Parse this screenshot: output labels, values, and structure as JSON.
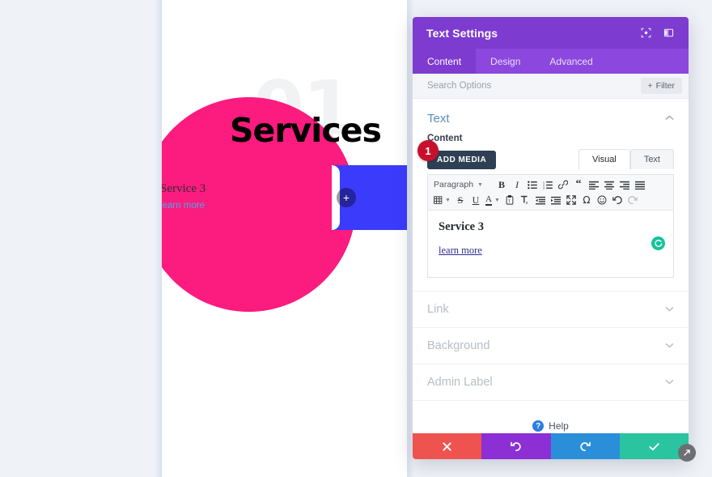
{
  "canvas": {
    "watermark_number": "01",
    "section_heading": "Services",
    "service_title": "Service 3",
    "service_link": "learn more",
    "add_module_glyph": "+",
    "colors": {
      "page_background": "#eff2f7",
      "canvas_background": "#ffffff",
      "pink_circle": "#fc1b7e",
      "blue_rect": "#3b3bfc",
      "watermark": "#f1f2f4",
      "heading": "#000000",
      "link": "#49a7e9"
    }
  },
  "modal": {
    "title": "Text Settings",
    "header_icons": [
      {
        "name": "fullscreen-target-icon"
      },
      {
        "name": "panel-layout-icon"
      }
    ],
    "tabs": [
      {
        "label": "Content",
        "active": true
      },
      {
        "label": "Design",
        "active": false
      },
      {
        "label": "Advanced",
        "active": false
      }
    ],
    "search": {
      "placeholder": "Search Options",
      "value": "",
      "filter_label": "Filter",
      "filter_glyph": "+"
    },
    "text_section": {
      "title": "Text",
      "expanded": true,
      "chevron": "⌃",
      "content_label": "Content",
      "add_media_label": "ADD MEDIA",
      "editor_tabs": [
        {
          "label": "Visual",
          "active": true
        },
        {
          "label": "Text",
          "active": false
        }
      ],
      "toolbar": {
        "paragraph_label": "Paragraph",
        "row1": [
          {
            "name": "bold-icon",
            "glyph": "B"
          },
          {
            "name": "italic-icon",
            "glyph": "I"
          },
          {
            "name": "bulleted-list-icon",
            "glyph": "☰"
          },
          {
            "name": "numbered-list-icon",
            "glyph": "≡"
          },
          {
            "name": "link-icon",
            "glyph": "🔗"
          },
          {
            "name": "blockquote-icon",
            "glyph": "“"
          },
          {
            "name": "align-left-icon",
            "glyph": "≡"
          },
          {
            "name": "align-center-icon",
            "glyph": "≡"
          },
          {
            "name": "align-right-icon",
            "glyph": "≡"
          },
          {
            "name": "align-justify-icon",
            "glyph": "≡"
          }
        ],
        "row2": [
          {
            "name": "table-icon",
            "glyph": "⊞"
          },
          {
            "name": "strikethrough-icon",
            "glyph": "S"
          },
          {
            "name": "underline-icon",
            "glyph": "U"
          },
          {
            "name": "text-color-icon",
            "glyph": "A"
          },
          {
            "name": "paste-as-text-icon",
            "glyph": "📋"
          },
          {
            "name": "clear-formatting-icon",
            "glyph": "T"
          },
          {
            "name": "outdent-icon",
            "glyph": "≡"
          },
          {
            "name": "indent-icon",
            "glyph": "≡"
          },
          {
            "name": "fullscreen-icon",
            "glyph": "⤢"
          },
          {
            "name": "special-character-icon",
            "glyph": "Ω"
          },
          {
            "name": "emoji-icon",
            "glyph": "☺"
          },
          {
            "name": "undo-icon",
            "glyph": "↶"
          },
          {
            "name": "redo-icon",
            "glyph": "↷"
          }
        ]
      },
      "editor_content": {
        "heading": "Service 3",
        "link_text": "learn more"
      },
      "grammar_badge": "grammar-check-badge"
    },
    "accordions": [
      {
        "label": "Link",
        "chevron": "⌄"
      },
      {
        "label": "Background",
        "chevron": "⌄"
      },
      {
        "label": "Admin Label",
        "chevron": "⌄"
      }
    ],
    "help": {
      "label": "Help",
      "glyph": "?"
    },
    "footer": [
      {
        "name": "cancel-button",
        "glyph": "✖",
        "color": "#ef5350"
      },
      {
        "name": "undo-button",
        "glyph": "↺",
        "color": "#8c2fd4"
      },
      {
        "name": "redo-button",
        "glyph": "↻",
        "color": "#2a8fd8"
      },
      {
        "name": "save-button",
        "glyph": "✔",
        "color": "#2ac4a1"
      }
    ],
    "step_marker": "1"
  }
}
